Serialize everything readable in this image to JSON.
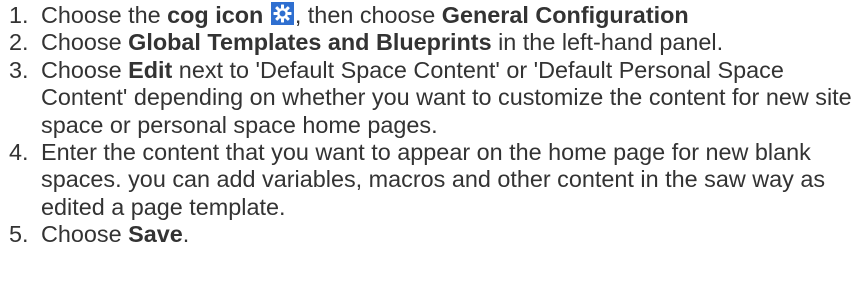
{
  "steps": [
    {
      "number": "1.",
      "parts": {
        "a": "Choose the ",
        "b": "cog icon",
        "c": " ",
        "d": ", then choose ",
        "e": "General Configuration"
      },
      "icon": {
        "name": "cog-icon",
        "color": "#2f6fd0"
      }
    },
    {
      "number": "2.",
      "parts": {
        "a": "Choose ",
        "b": "Global Templates and Blueprints",
        "c": " in the left-hand panel."
      }
    },
    {
      "number": "3.",
      "parts": {
        "a": "Choose ",
        "b": "Edit",
        "c": " next to 'Default Space Content' or 'Default Personal Space Content' depending on whether you want to customize the content for new site space or personal space home pages."
      }
    },
    {
      "number": "4.",
      "parts": {
        "a": "Enter the content that you want to appear on the home page for new blank spaces. you can add variables, macros and other content in the saw way as edited a page template."
      }
    },
    {
      "number": "5.",
      "parts": {
        "a": "Choose ",
        "b": "Save",
        "c": "."
      }
    }
  ]
}
